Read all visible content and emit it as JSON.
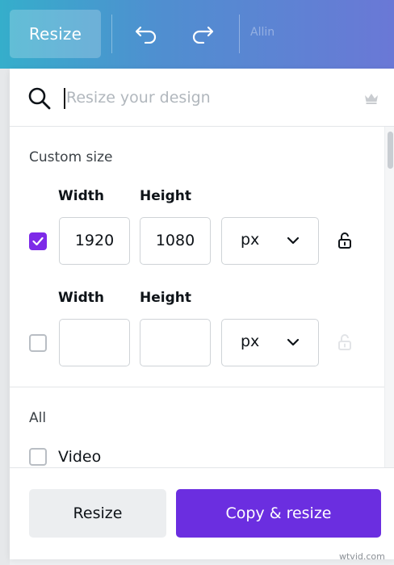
{
  "topbar": {
    "resize_label": "Resize",
    "faded_label": "Allin"
  },
  "search": {
    "placeholder": "Resize your design"
  },
  "custom_size": {
    "heading": "Custom size",
    "rows": [
      {
        "checked": true,
        "width_label": "Width",
        "height_label": "Height",
        "width": "1920",
        "height": "1080",
        "unit": "px",
        "lock_enabled": true
      },
      {
        "checked": false,
        "width_label": "Width",
        "height_label": "Height",
        "width": "",
        "height": "",
        "unit": "px",
        "lock_enabled": false
      }
    ]
  },
  "all_section": {
    "heading": "All",
    "items": [
      {
        "label": "Video",
        "checked": false
      }
    ]
  },
  "footer": {
    "resize_label": "Resize",
    "copy_resize_label": "Copy & resize"
  },
  "watermark": "wtvid.com",
  "colors": {
    "accent_purple": "#7d2ae8",
    "primary_button": "#6b2ee0",
    "topbar_gradient_start": "#35aecb",
    "topbar_gradient_end": "#6a78d6"
  }
}
